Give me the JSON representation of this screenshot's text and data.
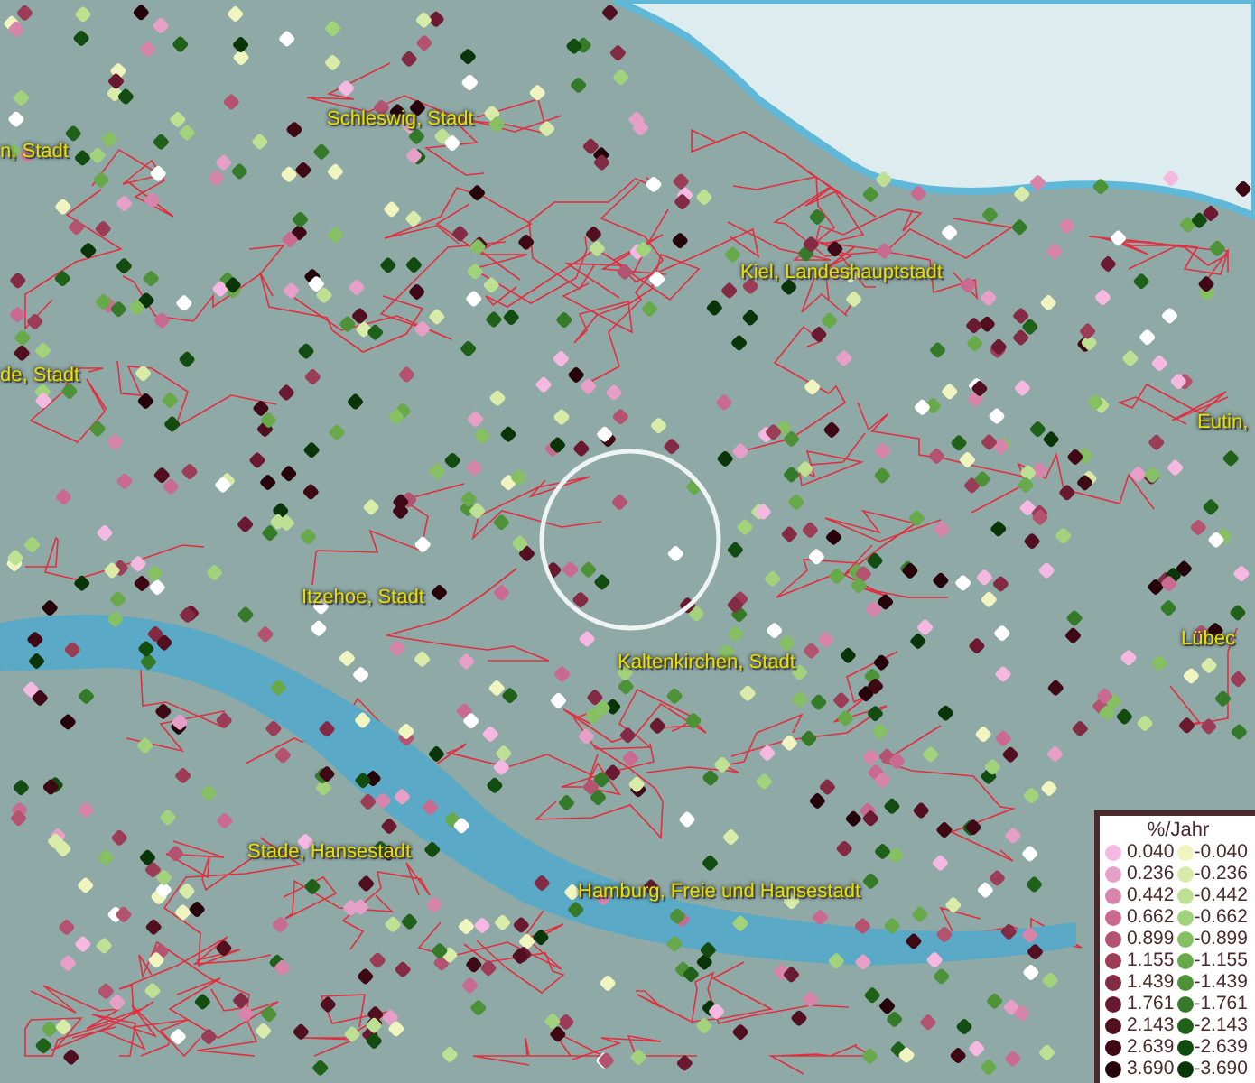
{
  "map": {
    "place_labels": [
      {
        "text": "Schleswig, Stadt"
      },
      {
        "text": "n, Stadt"
      },
      {
        "text": "Kiel, Landeshauptstadt"
      },
      {
        "text": "de, Stadt"
      },
      {
        "text": "Eutin,"
      },
      {
        "text": "Itzehoe, Stadt"
      },
      {
        "text": "Kaltenkirchen, Stadt"
      },
      {
        "text": "Lübec"
      },
      {
        "text": "Stade, Hansestadt"
      },
      {
        "text": "Hamburg, Freie und Hansestadt"
      }
    ]
  },
  "legend": {
    "title": "%/Jahr",
    "rows": [
      {
        "positive": {
          "value": "0.040",
          "color": "#f5b8e0"
        },
        "negative": {
          "value": "-0.040",
          "color": "#f0f5c0"
        }
      },
      {
        "positive": {
          "value": "0.236",
          "color": "#e6a0c8"
        },
        "negative": {
          "value": "-0.236",
          "color": "#d8eba8"
        }
      },
      {
        "positive": {
          "value": "0.442",
          "color": "#d885ab"
        },
        "negative": {
          "value": "-0.442",
          "color": "#bde093"
        }
      },
      {
        "positive": {
          "value": "0.662",
          "color": "#c96b91"
        },
        "negative": {
          "value": "-0.662",
          "color": "#a2d27c"
        }
      },
      {
        "positive": {
          "value": "0.899",
          "color": "#b3536f"
        },
        "negative": {
          "value": "-0.899",
          "color": "#86c063"
        }
      },
      {
        "positive": {
          "value": "1.155",
          "color": "#9c3d58"
        },
        "negative": {
          "value": "-1.155",
          "color": "#68aa4a"
        }
      },
      {
        "positive": {
          "value": "1.439",
          "color": "#832a44"
        },
        "negative": {
          "value": "-1.439",
          "color": "#4e9238"
        }
      },
      {
        "positive": {
          "value": "1.761",
          "color": "#6a1a30"
        },
        "negative": {
          "value": "-1.761",
          "color": "#357a28"
        }
      },
      {
        "positive": {
          "value": "2.143",
          "color": "#520f20"
        },
        "negative": {
          "value": "-2.143",
          "color": "#20611a"
        }
      },
      {
        "positive": {
          "value": "2.639",
          "color": "#3e0814"
        },
        "negative": {
          "value": "-2.639",
          "color": "#134c10"
        }
      },
      {
        "positive": {
          "value": "3.690",
          "color": "#26030a"
        },
        "negative": {
          "value": "-3.690",
          "color": "#0a3508"
        }
      }
    ]
  }
}
